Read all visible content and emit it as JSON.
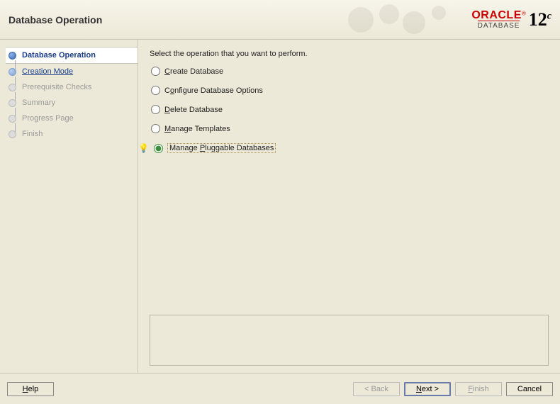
{
  "header": {
    "title": "Database Operation",
    "brand_primary": "ORACLE",
    "brand_sub": "DATABASE",
    "version": "12",
    "version_suffix": "c"
  },
  "sidebar": {
    "steps": [
      {
        "label": "Database Operation",
        "state": "current"
      },
      {
        "label": "Creation Mode",
        "state": "next"
      },
      {
        "label": "Prerequisite Checks",
        "state": "disabled"
      },
      {
        "label": "Summary",
        "state": "disabled"
      },
      {
        "label": "Progress Page",
        "state": "disabled"
      },
      {
        "label": "Finish",
        "state": "disabled"
      }
    ]
  },
  "main": {
    "prompt": "Select the operation that you want to perform.",
    "options": [
      {
        "label": "Create Database",
        "accel": "C",
        "selected": false
      },
      {
        "label": "Configure Database Options",
        "accel": "o",
        "selected": false
      },
      {
        "label": "Delete Database",
        "accel": "D",
        "selected": false
      },
      {
        "label": "Manage Templates",
        "accel": "M",
        "selected": false
      },
      {
        "label": "Manage Pluggable Databases",
        "accel": "P",
        "selected": true,
        "tip": true
      }
    ]
  },
  "footer": {
    "help": "Help",
    "back": "< Back",
    "next": "Next >",
    "finish": "Finish",
    "cancel": "Cancel"
  }
}
